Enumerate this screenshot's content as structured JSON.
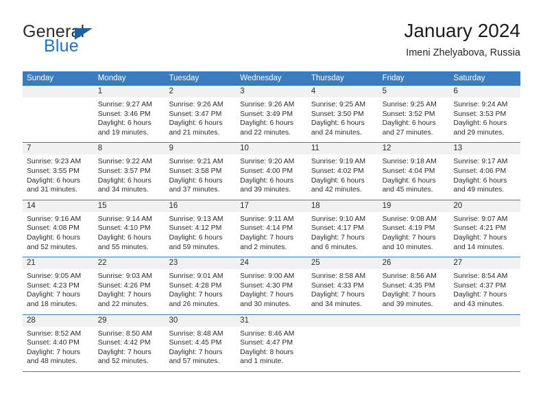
{
  "brand": {
    "word1": "General",
    "word2": "Blue",
    "logo_icon": "triangle-flag-icon",
    "accent_color": "#1f72bd"
  },
  "header": {
    "title": "January 2024",
    "subtitle": "Imeni Zhelyabova, Russia"
  },
  "calendar": {
    "header_bg": "#3a7cbd",
    "day_strip_bg": "#f1f1f1",
    "weekdays": [
      "Sunday",
      "Monday",
      "Tuesday",
      "Wednesday",
      "Thursday",
      "Friday",
      "Saturday"
    ],
    "weeks": [
      [
        {
          "day": "",
          "empty": true,
          "lines": []
        },
        {
          "day": "1",
          "lines": [
            "Sunrise: 9:27 AM",
            "Sunset: 3:46 PM",
            "Daylight: 6 hours",
            "and 19 minutes."
          ]
        },
        {
          "day": "2",
          "lines": [
            "Sunrise: 9:26 AM",
            "Sunset: 3:47 PM",
            "Daylight: 6 hours",
            "and 21 minutes."
          ]
        },
        {
          "day": "3",
          "lines": [
            "Sunrise: 9:26 AM",
            "Sunset: 3:49 PM",
            "Daylight: 6 hours",
            "and 22 minutes."
          ]
        },
        {
          "day": "4",
          "lines": [
            "Sunrise: 9:25 AM",
            "Sunset: 3:50 PM",
            "Daylight: 6 hours",
            "and 24 minutes."
          ]
        },
        {
          "day": "5",
          "lines": [
            "Sunrise: 9:25 AM",
            "Sunset: 3:52 PM",
            "Daylight: 6 hours",
            "and 27 minutes."
          ]
        },
        {
          "day": "6",
          "lines": [
            "Sunrise: 9:24 AM",
            "Sunset: 3:53 PM",
            "Daylight: 6 hours",
            "and 29 minutes."
          ]
        }
      ],
      [
        {
          "day": "7",
          "lines": [
            "Sunrise: 9:23 AM",
            "Sunset: 3:55 PM",
            "Daylight: 6 hours",
            "and 31 minutes."
          ]
        },
        {
          "day": "8",
          "lines": [
            "Sunrise: 9:22 AM",
            "Sunset: 3:57 PM",
            "Daylight: 6 hours",
            "and 34 minutes."
          ]
        },
        {
          "day": "9",
          "lines": [
            "Sunrise: 9:21 AM",
            "Sunset: 3:58 PM",
            "Daylight: 6 hours",
            "and 37 minutes."
          ]
        },
        {
          "day": "10",
          "lines": [
            "Sunrise: 9:20 AM",
            "Sunset: 4:00 PM",
            "Daylight: 6 hours",
            "and 39 minutes."
          ]
        },
        {
          "day": "11",
          "lines": [
            "Sunrise: 9:19 AM",
            "Sunset: 4:02 PM",
            "Daylight: 6 hours",
            "and 42 minutes."
          ]
        },
        {
          "day": "12",
          "lines": [
            "Sunrise: 9:18 AM",
            "Sunset: 4:04 PM",
            "Daylight: 6 hours",
            "and 45 minutes."
          ]
        },
        {
          "day": "13",
          "lines": [
            "Sunrise: 9:17 AM",
            "Sunset: 4:06 PM",
            "Daylight: 6 hours",
            "and 49 minutes."
          ]
        }
      ],
      [
        {
          "day": "14",
          "lines": [
            "Sunrise: 9:16 AM",
            "Sunset: 4:08 PM",
            "Daylight: 6 hours",
            "and 52 minutes."
          ]
        },
        {
          "day": "15",
          "lines": [
            "Sunrise: 9:14 AM",
            "Sunset: 4:10 PM",
            "Daylight: 6 hours",
            "and 55 minutes."
          ]
        },
        {
          "day": "16",
          "lines": [
            "Sunrise: 9:13 AM",
            "Sunset: 4:12 PM",
            "Daylight: 6 hours",
            "and 59 minutes."
          ]
        },
        {
          "day": "17",
          "lines": [
            "Sunrise: 9:11 AM",
            "Sunset: 4:14 PM",
            "Daylight: 7 hours",
            "and 2 minutes."
          ]
        },
        {
          "day": "18",
          "lines": [
            "Sunrise: 9:10 AM",
            "Sunset: 4:17 PM",
            "Daylight: 7 hours",
            "and 6 minutes."
          ]
        },
        {
          "day": "19",
          "lines": [
            "Sunrise: 9:08 AM",
            "Sunset: 4:19 PM",
            "Daylight: 7 hours",
            "and 10 minutes."
          ]
        },
        {
          "day": "20",
          "lines": [
            "Sunrise: 9:07 AM",
            "Sunset: 4:21 PM",
            "Daylight: 7 hours",
            "and 14 minutes."
          ]
        }
      ],
      [
        {
          "day": "21",
          "lines": [
            "Sunrise: 9:05 AM",
            "Sunset: 4:23 PM",
            "Daylight: 7 hours",
            "and 18 minutes."
          ]
        },
        {
          "day": "22",
          "lines": [
            "Sunrise: 9:03 AM",
            "Sunset: 4:26 PM",
            "Daylight: 7 hours",
            "and 22 minutes."
          ]
        },
        {
          "day": "23",
          "lines": [
            "Sunrise: 9:01 AM",
            "Sunset: 4:28 PM",
            "Daylight: 7 hours",
            "and 26 minutes."
          ]
        },
        {
          "day": "24",
          "lines": [
            "Sunrise: 9:00 AM",
            "Sunset: 4:30 PM",
            "Daylight: 7 hours",
            "and 30 minutes."
          ]
        },
        {
          "day": "25",
          "lines": [
            "Sunrise: 8:58 AM",
            "Sunset: 4:33 PM",
            "Daylight: 7 hours",
            "and 34 minutes."
          ]
        },
        {
          "day": "26",
          "lines": [
            "Sunrise: 8:56 AM",
            "Sunset: 4:35 PM",
            "Daylight: 7 hours",
            "and 39 minutes."
          ]
        },
        {
          "day": "27",
          "lines": [
            "Sunrise: 8:54 AM",
            "Sunset: 4:37 PM",
            "Daylight: 7 hours",
            "and 43 minutes."
          ]
        }
      ],
      [
        {
          "day": "28",
          "lines": [
            "Sunrise: 8:52 AM",
            "Sunset: 4:40 PM",
            "Daylight: 7 hours",
            "and 48 minutes."
          ]
        },
        {
          "day": "29",
          "lines": [
            "Sunrise: 8:50 AM",
            "Sunset: 4:42 PM",
            "Daylight: 7 hours",
            "and 52 minutes."
          ]
        },
        {
          "day": "30",
          "lines": [
            "Sunrise: 8:48 AM",
            "Sunset: 4:45 PM",
            "Daylight: 7 hours",
            "and 57 minutes."
          ]
        },
        {
          "day": "31",
          "lines": [
            "Sunrise: 8:46 AM",
            "Sunset: 4:47 PM",
            "Daylight: 8 hours",
            "and 1 minute."
          ]
        },
        {
          "day": "",
          "empty": true,
          "lines": []
        },
        {
          "day": "",
          "empty": true,
          "lines": []
        },
        {
          "day": "",
          "empty": true,
          "lines": []
        }
      ]
    ]
  }
}
